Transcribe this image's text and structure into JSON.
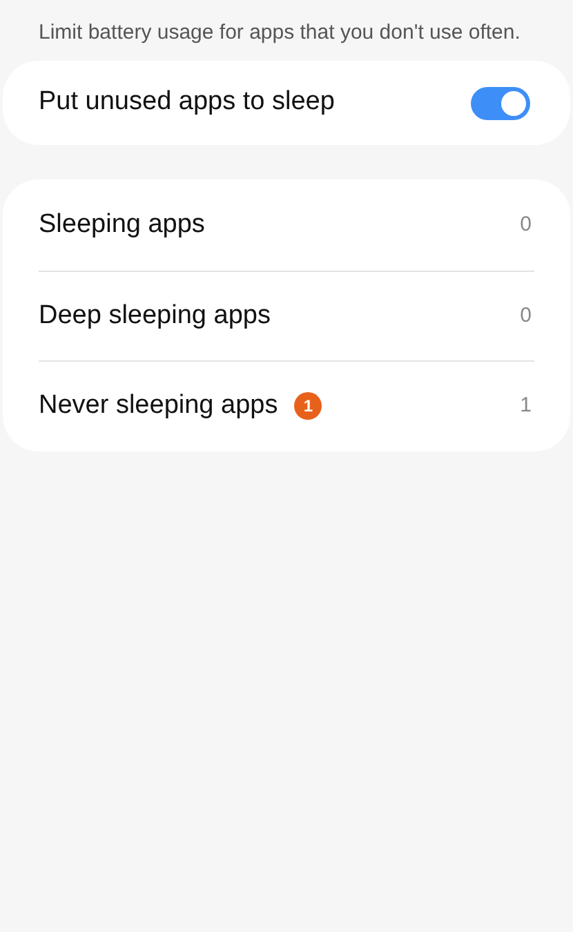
{
  "description": "Limit battery usage for apps that you don't use often.",
  "sleep_setting": {
    "label": "Put unused apps to sleep",
    "on": true
  },
  "app_lists": [
    {
      "label": "Sleeping apps",
      "count": "0"
    },
    {
      "label": "Deep sleeping apps",
      "count": "0"
    },
    {
      "label": "Never sleeping apps",
      "badge": "1",
      "count": "1"
    }
  ]
}
